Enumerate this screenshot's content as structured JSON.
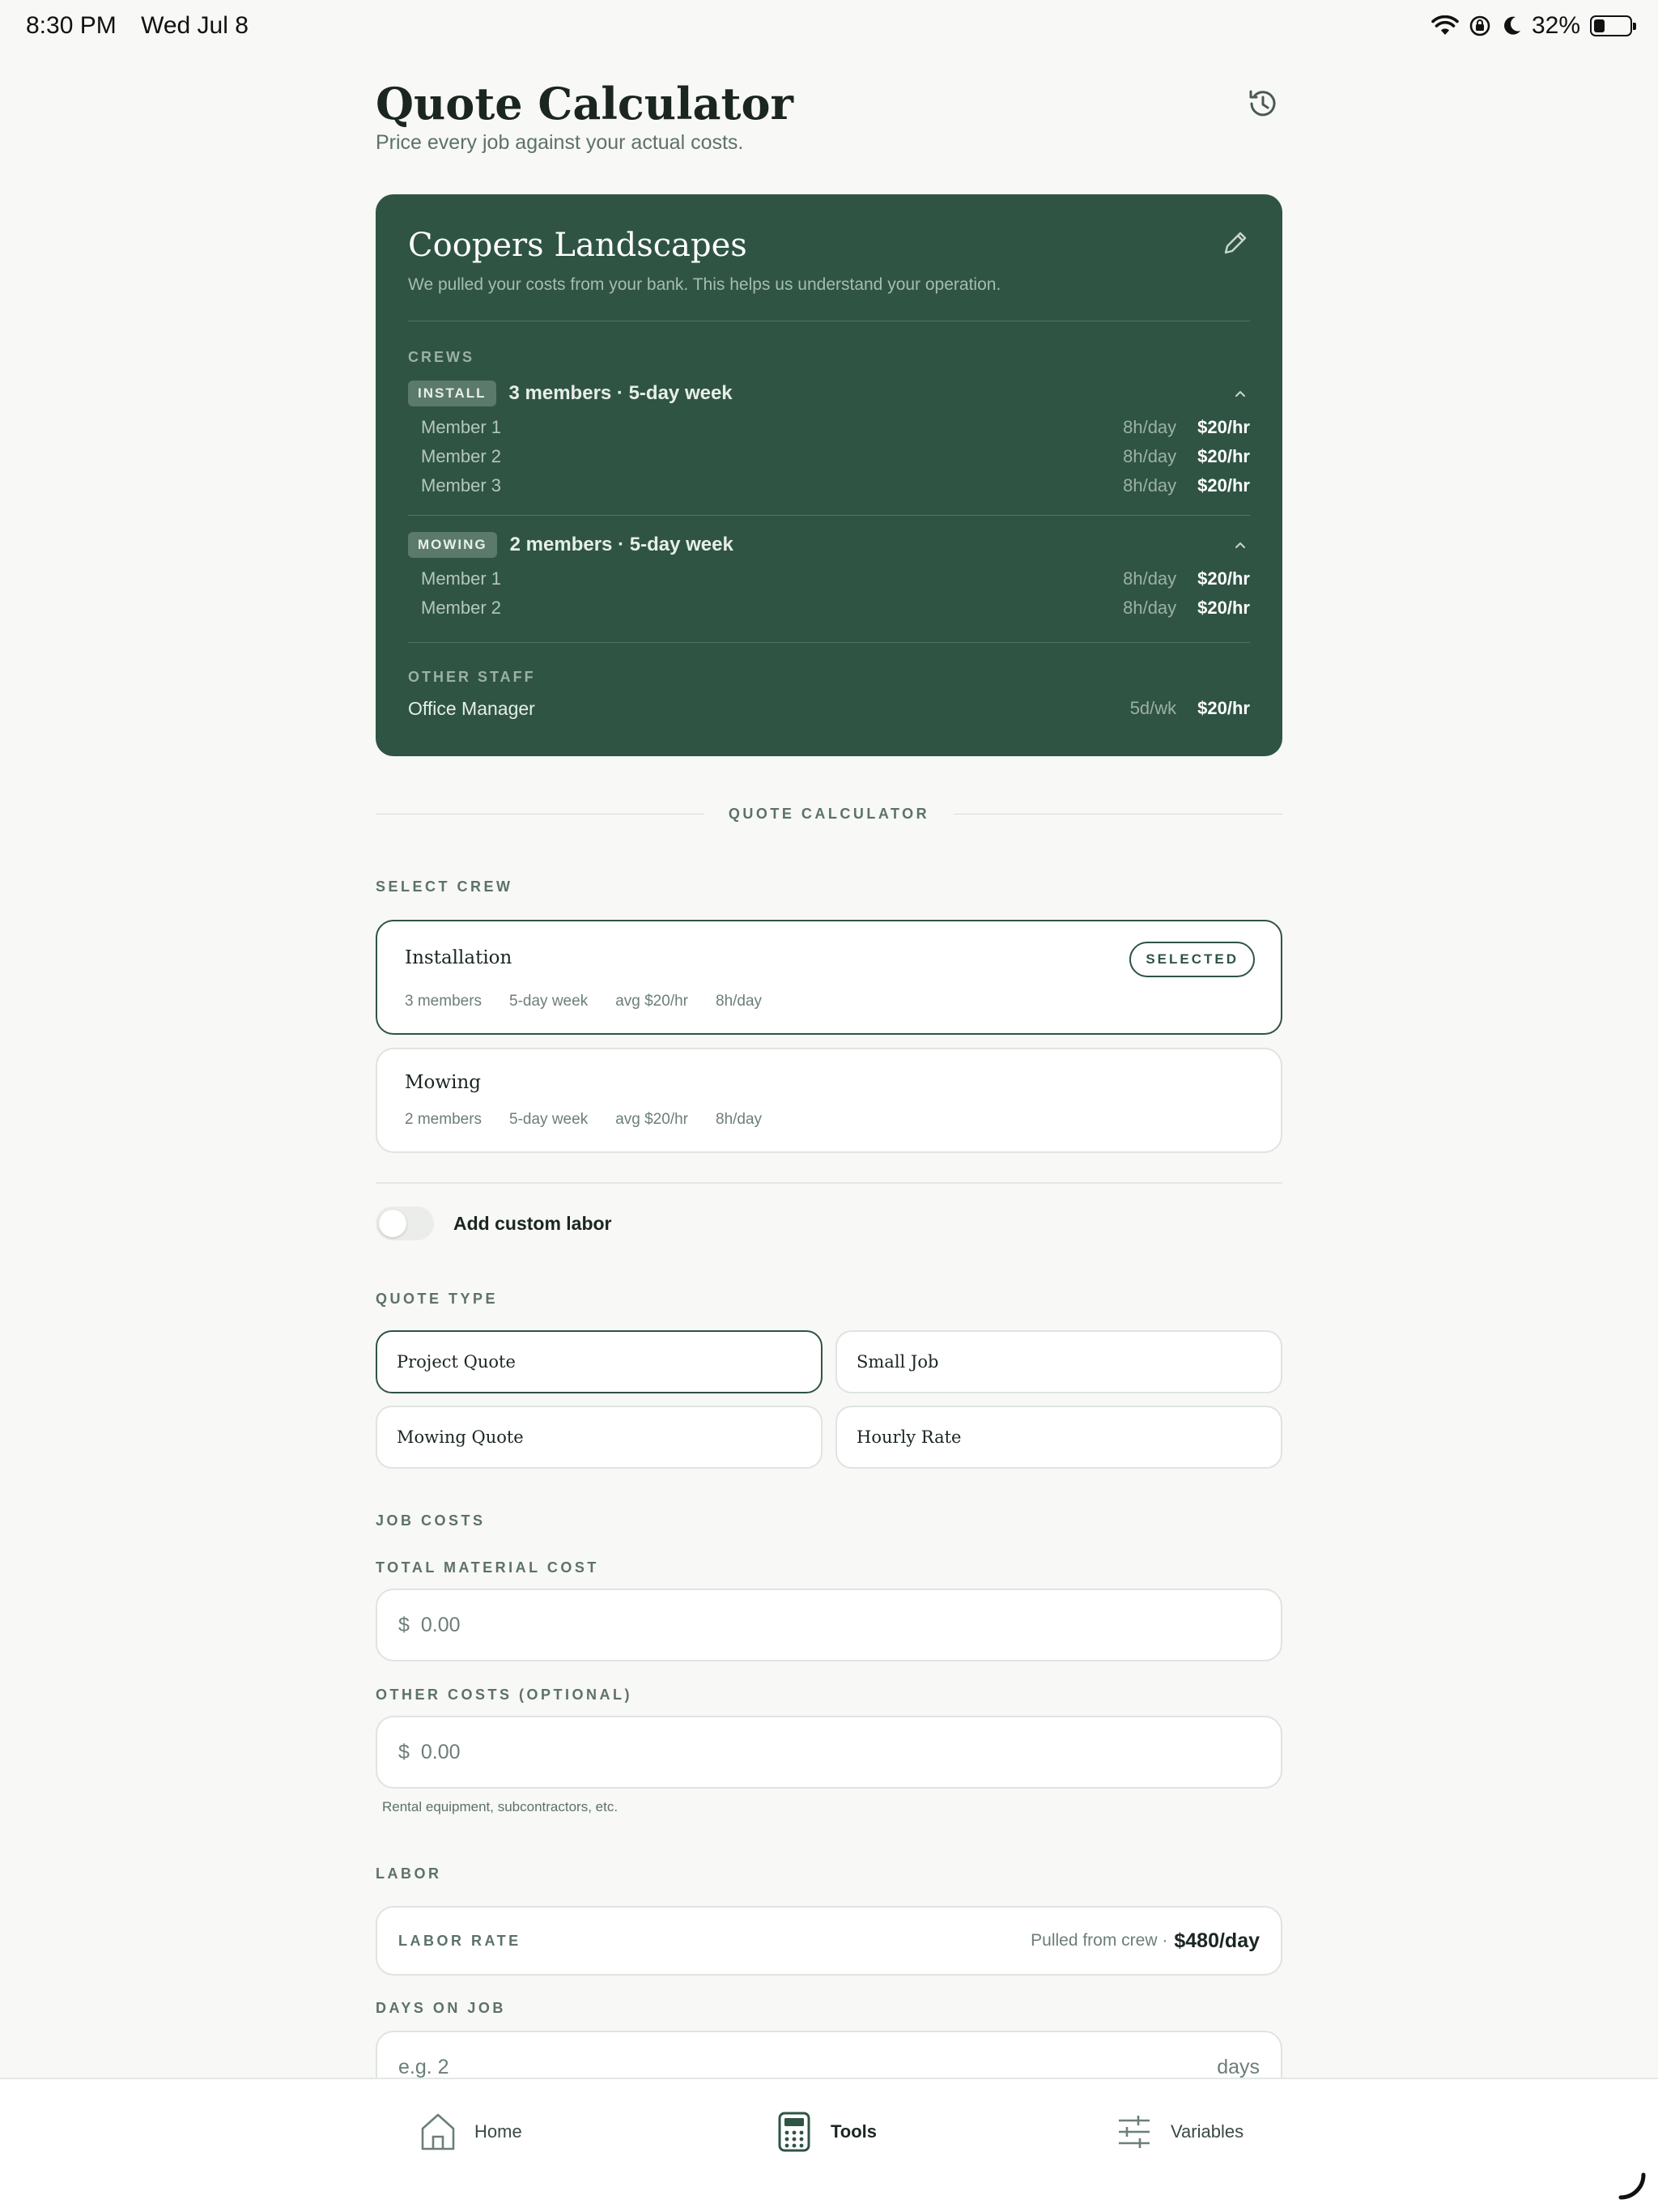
{
  "status_bar": {
    "time": "8:30 PM",
    "date": "Wed Jul 8",
    "battery": "32%",
    "battery_level": 0.32
  },
  "header": {
    "title": "Quote Calculator",
    "subtitle": "Price every job against your actual costs."
  },
  "company": {
    "name": "Coopers Landscapes",
    "description": "We pulled your costs from your bank. This helps us understand your operation.",
    "crews_label": "CREWS",
    "crews": [
      {
        "badge": "INSTALL",
        "summary": "3 members · 5-day week",
        "members": [
          {
            "name": "Member 1",
            "hours": "8h/day",
            "rate": "$20/hr"
          },
          {
            "name": "Member 2",
            "hours": "8h/day",
            "rate": "$20/hr"
          },
          {
            "name": "Member 3",
            "hours": "8h/day",
            "rate": "$20/hr"
          }
        ]
      },
      {
        "badge": "MOWING",
        "summary": "2 members · 5-day week",
        "members": [
          {
            "name": "Member 1",
            "hours": "8h/day",
            "rate": "$20/hr"
          },
          {
            "name": "Member 2",
            "hours": "8h/day",
            "rate": "$20/hr"
          }
        ]
      }
    ],
    "other_staff_label": "OTHER STAFF",
    "other_staff": [
      {
        "name": "Office Manager",
        "schedule": "5d/wk",
        "rate": "$20/hr"
      }
    ]
  },
  "calculator": {
    "divider_label": "QUOTE CALCULATOR",
    "select_crew_label": "SELECT CREW",
    "crew_options": [
      {
        "name": "Installation",
        "members": "3 members",
        "week": "5-day week",
        "avg": "avg $20/hr",
        "hours": "8h/day",
        "selected_label": "SELECTED"
      },
      {
        "name": "Mowing",
        "members": "2 members",
        "week": "5-day week",
        "avg": "avg $20/hr",
        "hours": "8h/day"
      }
    ],
    "custom_labor_label": "Add custom labor",
    "quote_type_label": "QUOTE TYPE",
    "quote_types": [
      "Project Quote",
      "Small Job",
      "Mowing Quote",
      "Hourly Rate"
    ],
    "job_costs_label": "JOB COSTS",
    "material_label": "TOTAL MATERIAL COST",
    "material_prefix": "$",
    "material_placeholder": "0.00",
    "other_costs_label": "OTHER COSTS (OPTIONAL)",
    "other_prefix": "$",
    "other_placeholder": "0.00",
    "other_help": "Rental equipment, subcontractors, etc.",
    "labor_label": "LABOR",
    "labor_rate_label": "LABOR RATE",
    "labor_rate_source": "Pulled from crew ·",
    "labor_rate_value": "$480/day",
    "days_label": "DAYS ON JOB",
    "days_placeholder": "e.g. 2",
    "days_suffix": "days"
  },
  "nav": {
    "home": "Home",
    "tools": "Tools",
    "variables": "Variables"
  },
  "colors": {
    "brand": "#2f5444",
    "background": "#f8f8f6"
  }
}
